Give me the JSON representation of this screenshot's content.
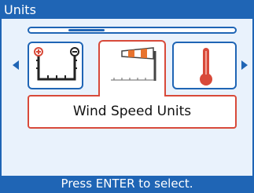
{
  "window": {
    "title": "Units"
  },
  "carousel": {
    "position_fraction": 0.23,
    "items": [
      {
        "icon": "pressure-gauge-icon"
      },
      {
        "icon": "windsock-icon"
      },
      {
        "icon": "thermometer-icon"
      }
    ],
    "selected_label": "Wind Speed Units"
  },
  "status": {
    "hint": "Press ENTER to select."
  },
  "colors": {
    "accent": "#1f65b5",
    "selection": "#d84a3a",
    "background": "#e9f2fc"
  }
}
